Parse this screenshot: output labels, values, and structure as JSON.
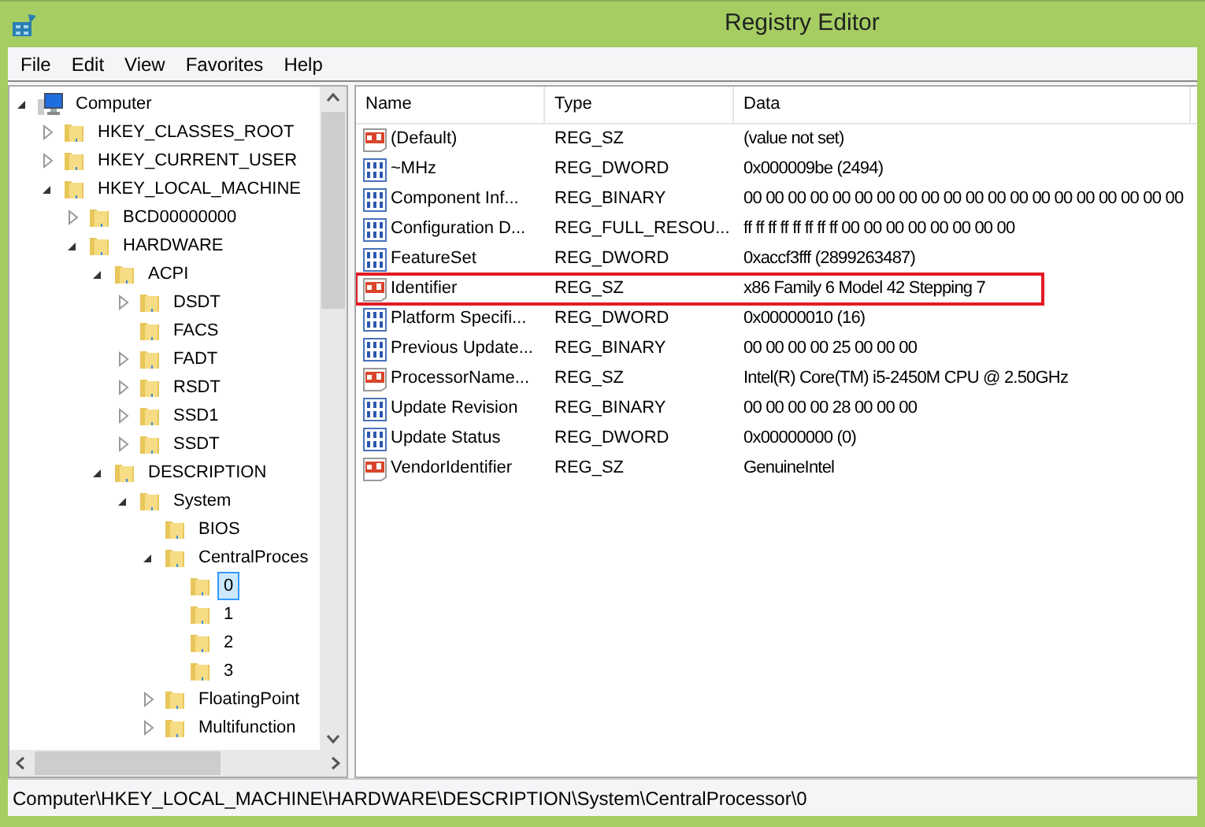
{
  "window": {
    "title": "Registry Editor"
  },
  "menu": [
    "File",
    "Edit",
    "View",
    "Favorites",
    "Help"
  ],
  "tree": [
    {
      "label": "Computer",
      "kind": "computer",
      "expanded": true,
      "selected": false,
      "children": [
        {
          "label": "HKEY_CLASSES_ROOT",
          "kind": "folder",
          "expanded": false,
          "selected": false
        },
        {
          "label": "HKEY_CURRENT_USER",
          "kind": "folder",
          "expanded": false,
          "selected": false
        },
        {
          "label": "HKEY_LOCAL_MACHINE",
          "kind": "folder",
          "expanded": true,
          "selected": false,
          "children": [
            {
              "label": "BCD00000000",
              "kind": "folder",
              "expanded": false,
              "selected": false
            },
            {
              "label": "HARDWARE",
              "kind": "folder",
              "expanded": true,
              "selected": false,
              "children": [
                {
                  "label": "ACPI",
                  "kind": "folder",
                  "expanded": true,
                  "selected": false,
                  "children": [
                    {
                      "label": "DSDT",
                      "kind": "folder",
                      "expanded": false,
                      "selected": false
                    },
                    {
                      "label": "FACS",
                      "kind": "folder",
                      "selected": false
                    },
                    {
                      "label": "FADT",
                      "kind": "folder",
                      "expanded": false,
                      "selected": false
                    },
                    {
                      "label": "RSDT",
                      "kind": "folder",
                      "expanded": false,
                      "selected": false
                    },
                    {
                      "label": "SSD1",
                      "kind": "folder",
                      "expanded": false,
                      "selected": false
                    },
                    {
                      "label": "SSDT",
                      "kind": "folder",
                      "expanded": false,
                      "selected": false
                    }
                  ]
                },
                {
                  "label": "DESCRIPTION",
                  "kind": "folder",
                  "expanded": true,
                  "selected": false,
                  "children": [
                    {
                      "label": "System",
                      "kind": "folder",
                      "expanded": true,
                      "selected": false,
                      "children": [
                        {
                          "label": "BIOS",
                          "kind": "folder",
                          "selected": false
                        },
                        {
                          "label": "CentralProces",
                          "kind": "folder",
                          "expanded": true,
                          "selected": false,
                          "children": [
                            {
                              "label": "0",
                              "kind": "folder",
                              "selected": true
                            },
                            {
                              "label": "1",
                              "kind": "folder",
                              "selected": false
                            },
                            {
                              "label": "2",
                              "kind": "folder",
                              "selected": false
                            },
                            {
                              "label": "3",
                              "kind": "folder",
                              "selected": false
                            }
                          ]
                        },
                        {
                          "label": "FloatingPoint",
                          "kind": "folder",
                          "expanded": false,
                          "selected": false
                        },
                        {
                          "label": "Multifunction",
                          "kind": "folder",
                          "expanded": false,
                          "selected": false
                        }
                      ]
                    }
                  ]
                }
              ]
            }
          ]
        }
      ]
    }
  ],
  "table": {
    "columns": [
      "Name",
      "Type",
      "Data"
    ],
    "rows": [
      {
        "kind": "string",
        "name": "(Default)",
        "type": "REG_SZ",
        "data": "(value not set)",
        "highlighted": false
      },
      {
        "kind": "binary",
        "name": "~MHz",
        "type": "REG_DWORD",
        "data": "0x000009be (2494)",
        "highlighted": false
      },
      {
        "kind": "binary",
        "name": "Component Inf...",
        "type": "REG_BINARY",
        "data": "00 00 00 00 00 00 00 00 00 00 00 00 00 00 00 00 00 00 00 00",
        "highlighted": false
      },
      {
        "kind": "binary",
        "name": "Configuration D...",
        "type": "REG_FULL_RESOU...",
        "data": "ff ff ff ff ff ff ff ff 00 00 00 00 00 00 00 00",
        "highlighted": false
      },
      {
        "kind": "binary",
        "name": "FeatureSet",
        "type": "REG_DWORD",
        "data": "0xaccf3fff (2899263487)",
        "highlighted": false
      },
      {
        "kind": "string",
        "name": "Identifier",
        "type": "REG_SZ",
        "data": "x86 Family 6 Model 42 Stepping 7",
        "highlighted": true
      },
      {
        "kind": "binary",
        "name": "Platform Specifi...",
        "type": "REG_DWORD",
        "data": "0x00000010 (16)",
        "highlighted": false
      },
      {
        "kind": "binary",
        "name": "Previous Update...",
        "type": "REG_BINARY",
        "data": "00 00 00 00 25 00 00 00",
        "highlighted": false
      },
      {
        "kind": "string",
        "name": "ProcessorName...",
        "type": "REG_SZ",
        "data": "Intel(R) Core(TM) i5-2450M CPU @ 2.50GHz",
        "highlighted": false
      },
      {
        "kind": "binary",
        "name": "Update Revision",
        "type": "REG_BINARY",
        "data": "00 00 00 00 28 00 00 00",
        "highlighted": false
      },
      {
        "kind": "binary",
        "name": "Update Status",
        "type": "REG_DWORD",
        "data": "0x00000000 (0)",
        "highlighted": false
      },
      {
        "kind": "string",
        "name": "VendorIdentifier",
        "type": "REG_SZ",
        "data": "GenuineIntel",
        "highlighted": false
      }
    ]
  },
  "status_bar": "Computer\\HKEY_LOCAL_MACHINE\\HARDWARE\\DESCRIPTION\\System\\CentralProcessor\\0"
}
